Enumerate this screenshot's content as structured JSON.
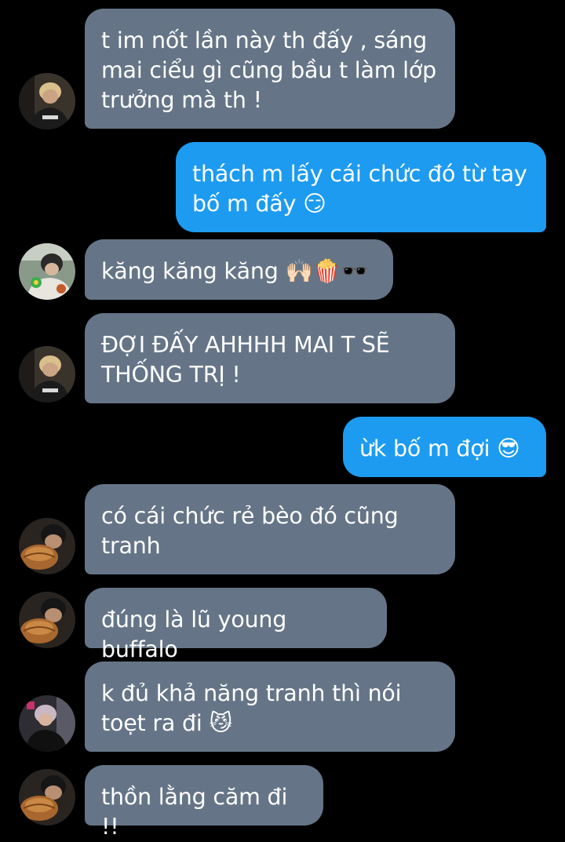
{
  "theme": {
    "background": "#000000",
    "incoming_bubble": "#657587",
    "outgoing_bubble": "#1d9bf0",
    "text_color": "#ffffff"
  },
  "messages": [
    {
      "direction": "incoming",
      "sender_avatar": "blonde-hoodie-avatar",
      "text": "t im nốt lần này th đấy , sáng\nmai ciểu gì cũng bầu t làm lớp\ntrưởng mà th !"
    },
    {
      "direction": "outgoing",
      "text": "thách m lấy cái chức đó từ tay\nbố m đấy 😏"
    },
    {
      "direction": "incoming",
      "sender_avatar": "green-flower-avatar",
      "text": "kăng kăng kăng 🙌🏻🍿🕶️"
    },
    {
      "direction": "incoming",
      "sender_avatar": "blonde-hoodie-avatar",
      "text": "ĐỢI ĐẤY AHHHH MAI T SẼ\nTHỐNG TRỊ !"
    },
    {
      "direction": "outgoing",
      "text": "ừk bố m đợi 😎"
    },
    {
      "direction": "incoming",
      "sender_avatar": "food-eating-avatar",
      "text": "có cái chức rẻ bèo đó cũng\ntranh"
    },
    {
      "direction": "incoming",
      "sender_avatar": "food-eating-avatar",
      "text": "đúng là lũ young buffalo"
    },
    {
      "direction": "incoming",
      "sender_avatar": "dark-jacket-avatar",
      "text": "k đủ khả năng tranh thì nói\ntoẹt ra đi 😼"
    },
    {
      "direction": "incoming",
      "sender_avatar": "food-eating-avatar",
      "text": "thồn lằng căm đi !!"
    }
  ]
}
